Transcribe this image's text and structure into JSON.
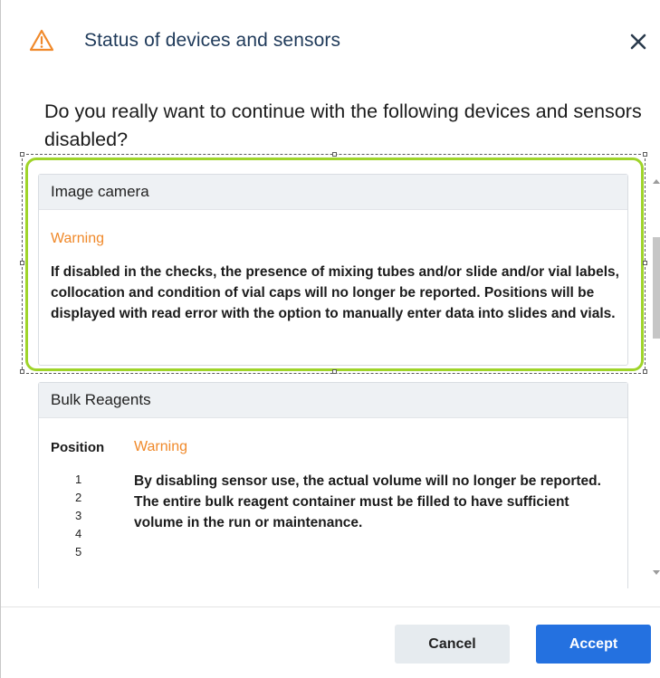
{
  "dialog": {
    "title": "Status of devices and sensors",
    "question": "Do you really want to continue with the following devices and sensors disabled?"
  },
  "cards": [
    {
      "header": "Image camera",
      "warning_label": "Warning",
      "text": "If disabled in the checks, the presence of mixing tubes and/or slide and/or vial labels, collocation and condition of vial caps will no longer be reported. Positions will be displayed with read error with the option to manually enter data into slides and vials."
    },
    {
      "header": "Bulk Reagents",
      "position_label": "Position",
      "warning_label": "Warning",
      "positions": [
        "1",
        "2",
        "3",
        "4",
        "5"
      ],
      "text": "By disabling sensor use, the actual volume will no longer be reported. The entire bulk reagent container must be filled to have sufficient volume in the run or maintenance."
    }
  ],
  "buttons": {
    "cancel": "Cancel",
    "accept": "Accept"
  },
  "colors": {
    "accent": "#2471e0",
    "warning": "#f0892a",
    "selection": "#9fd42a",
    "title": "#1f3a5a"
  },
  "icons": {
    "title_icon": "warning-triangle-icon",
    "close_icon": "close-icon"
  }
}
